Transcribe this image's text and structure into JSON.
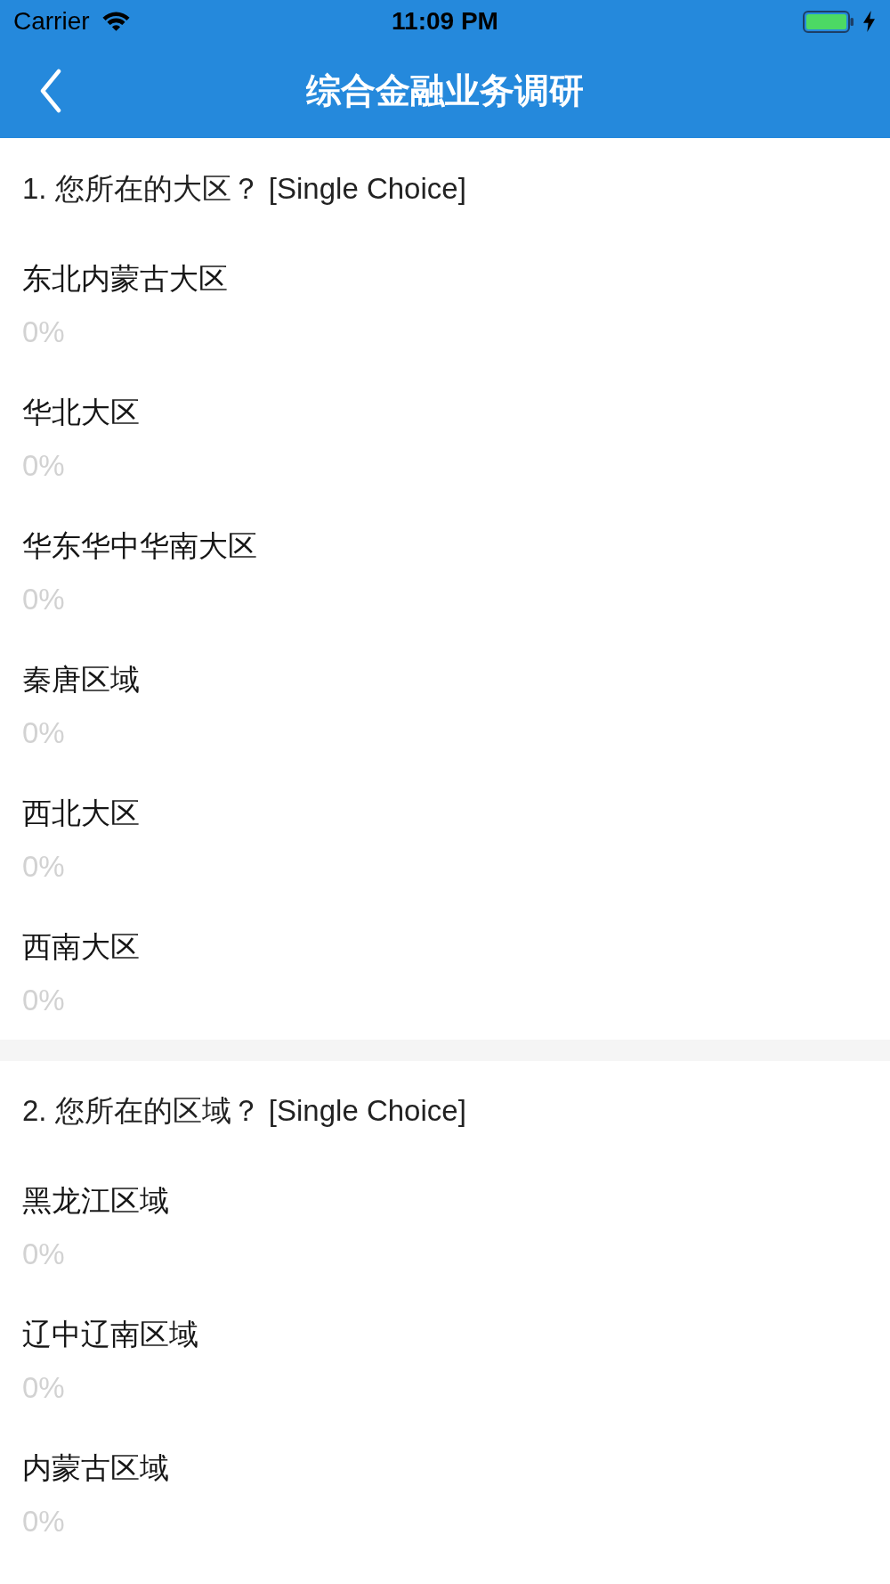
{
  "status_bar": {
    "carrier": "Carrier",
    "time": "11:09 PM"
  },
  "nav_bar": {
    "title": "综合金融业务调研"
  },
  "questions": [
    {
      "title": "1. 您所在的大区？ [Single Choice]",
      "options": [
        {
          "label": "东北内蒙古大区",
          "percent": "0%"
        },
        {
          "label": "华北大区",
          "percent": "0%"
        },
        {
          "label": "华东华中华南大区",
          "percent": "0%"
        },
        {
          "label": "秦唐区域",
          "percent": "0%"
        },
        {
          "label": "西北大区",
          "percent": "0%"
        },
        {
          "label": "西南大区",
          "percent": "0%"
        }
      ]
    },
    {
      "title": "2. 您所在的区域？ [Single Choice]",
      "options": [
        {
          "label": "黑龙江区域",
          "percent": "0%"
        },
        {
          "label": "辽中辽南区域",
          "percent": "0%"
        },
        {
          "label": "内蒙古区域",
          "percent": "0%"
        }
      ]
    }
  ]
}
